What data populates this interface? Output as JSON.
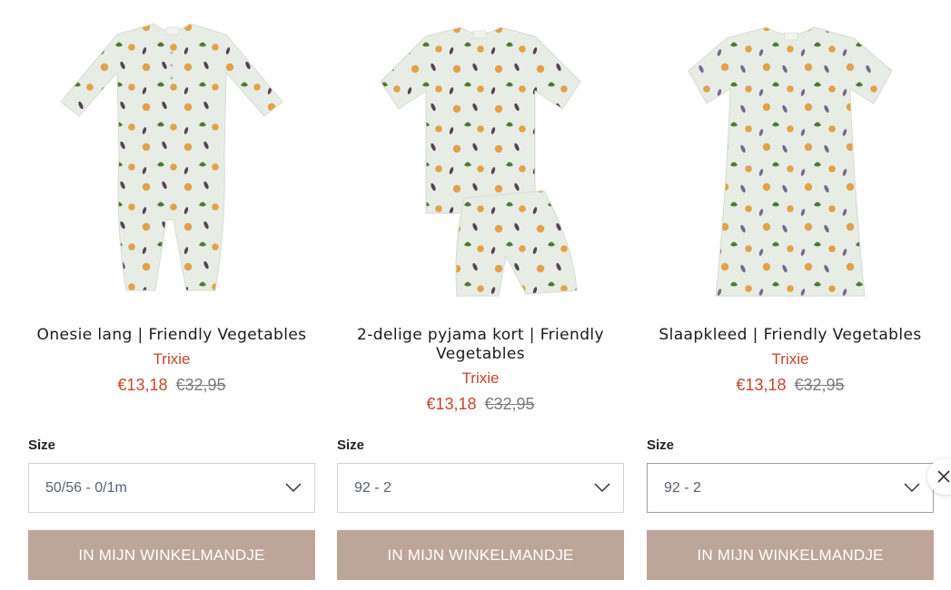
{
  "colors": {
    "sale": "#c8452d",
    "old_price": "#7a7a7a",
    "button_bg": "#bea59a",
    "button_text": "#ffffff",
    "fabric": "#e7ede5"
  },
  "products": [
    {
      "image_icon": "onesie-icon",
      "title": "Onesie lang | Friendly Vegetables",
      "brand": "Trixie",
      "price_sale": "€13,18",
      "price_old": "€32,95",
      "size_label": "Size",
      "size_value": "50/56 - 0/1m",
      "cart_label": "IN MIJN WINKELMANDJE"
    },
    {
      "image_icon": "pyjama-icon",
      "title": "2-delige pyjama kort | Friendly Vegetables",
      "brand": "Trixie",
      "price_sale": "€13,18",
      "price_old": "€32,95",
      "size_label": "Size",
      "size_value": "92 - 2",
      "cart_label": "IN MIJN WINKELMANDJE"
    },
    {
      "image_icon": "nightdress-icon",
      "title": "Slaapkleed | Friendly Vegetables",
      "brand": "Trixie",
      "price_sale": "€13,18",
      "price_old": "€32,95",
      "size_label": "Size",
      "size_value": "92 - 2",
      "cart_label": "IN MIJN WINKELMANDJE"
    }
  ],
  "close_icon": "close-icon"
}
